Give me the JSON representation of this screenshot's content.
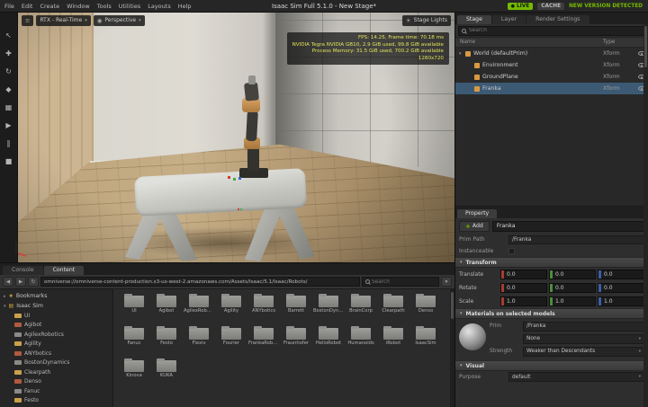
{
  "colors": {
    "accent_green": "#76b900",
    "selection_blue": "#3d5a74",
    "stats_yellow": "#e4e45a"
  },
  "icons": {
    "hamburger": "≡",
    "camera": "◉",
    "caret_down": "▾",
    "caret_right": "▸",
    "sun": "☀",
    "star": "★",
    "server": "▤",
    "plus": "+",
    "back": "◀",
    "forward": "▶",
    "refresh": "↻",
    "live_dot": "●"
  },
  "menubar": {
    "items": [
      "File",
      "Edit",
      "Create",
      "Window",
      "Tools",
      "Utilities",
      "Layouts",
      "Help"
    ],
    "title": "Isaac Sim Full 5.1.0 - New Stage*",
    "live_label": "LIVE",
    "cache_label": "CACHE",
    "version_label": "NEW VERSION DETECTED"
  },
  "viewport": {
    "renderer_label": "RTX - Real-Time",
    "camera_label": "Perspective",
    "stage_lights_label": "Stage Lights",
    "tools": [
      {
        "icon": "select-icon",
        "glyph": "↖"
      },
      {
        "icon": "move-icon",
        "glyph": "✚"
      },
      {
        "icon": "rotate-icon",
        "glyph": "↻"
      },
      {
        "icon": "scale-icon",
        "glyph": "◆"
      },
      {
        "icon": "snap-icon",
        "glyph": "▦"
      },
      {
        "icon": "play-icon",
        "glyph": "▶"
      },
      {
        "icon": "pause-icon",
        "glyph": "‖"
      },
      {
        "icon": "stop-icon",
        "glyph": "■"
      }
    ],
    "stats": {
      "fps_line": "FPS: 14.25, Frame time: 70.18 ms",
      "gpu_line": "NVIDIA Tegra NVIDIA GB10, 2.9 GiB used, 99.8 GiB available",
      "memory_line": "Process Memory: 31.5 GiB used, 700.2 GiB available",
      "resolution_line": "1280x720"
    }
  },
  "stage_panel": {
    "tabs": [
      {
        "label": "Stage",
        "active": true
      },
      {
        "label": "Layer",
        "active": false
      },
      {
        "label": "Render Settings",
        "active": false
      }
    ],
    "search_placeholder": "Search",
    "name_column": "Name",
    "type_column": "Type",
    "rows": [
      {
        "caret": "▾",
        "name": "World (defaultPrim)",
        "type": "Xform",
        "selected": false
      },
      {
        "caret": "",
        "name": "Environment",
        "type": "Xform",
        "selected": false
      },
      {
        "caret": "",
        "name": "GroundPlane",
        "type": "Xform",
        "selected": false
      },
      {
        "caret": "",
        "name": "Franka",
        "type": "Xform",
        "selected": true
      }
    ]
  },
  "property_panel": {
    "title": "Property",
    "add_button_label": "Add",
    "prim_name_value": "Franka",
    "prim_path_label": "Prim Path",
    "prim_path_value": "/Franka",
    "instanceable_label": "Instanceable",
    "transform": {
      "title": "Transform",
      "rows": [
        {
          "label": "Translate",
          "x": "0.0",
          "y": "0.0",
          "z": "0.0"
        },
        {
          "label": "Rotate",
          "x": "0.0",
          "y": "0.0",
          "z": "0.0"
        },
        {
          "label": "Scale",
          "x": "1.0",
          "y": "1.0",
          "z": "1.0"
        }
      ]
    },
    "materials": {
      "title": "Materials on selected models",
      "prim_label": "Prim",
      "prim_value": "/Franka",
      "material_value": "None",
      "strength_label": "Strength",
      "strength_value": "Weaker than Descendants"
    },
    "visual": {
      "title": "Visual",
      "purpose_label": "Purpose",
      "purpose_value": "default"
    }
  },
  "content_browser": {
    "tabs": [
      {
        "label": "Console",
        "active": false
      },
      {
        "label": "Content",
        "active": true
      }
    ],
    "path_value": "omniverse://omniverse-content-production.s3-us-west-2.amazonaws.com/Assets/Isaac/5.1/Isaac/Robots/",
    "search_placeholder": "Search",
    "bookmarks_label": "Bookmarks",
    "root_label": "Isaac Sim",
    "tree_items": [
      "UI",
      "Agibot",
      "AgilexRobotics",
      "Agility",
      "ANYbotics",
      "BostonDynamics",
      "Clearpath",
      "Denso",
      "Fanuc",
      "Festo"
    ],
    "folders": [
      "UI",
      "Agibot",
      "AgilexRobotics",
      "Agility",
      "ANYbotics",
      "Barrett",
      "BostonDynamics",
      "BrainCorp",
      "Clearpath",
      "Denso",
      "Fanuc",
      "Festo",
      "Flexiv",
      "Fourier",
      "FrankaRobotics",
      "Fraunhofer",
      "HelloRobot",
      "Humanoids",
      "iRobot",
      "IsaacSim",
      "Kinova",
      "KUKA"
    ]
  }
}
